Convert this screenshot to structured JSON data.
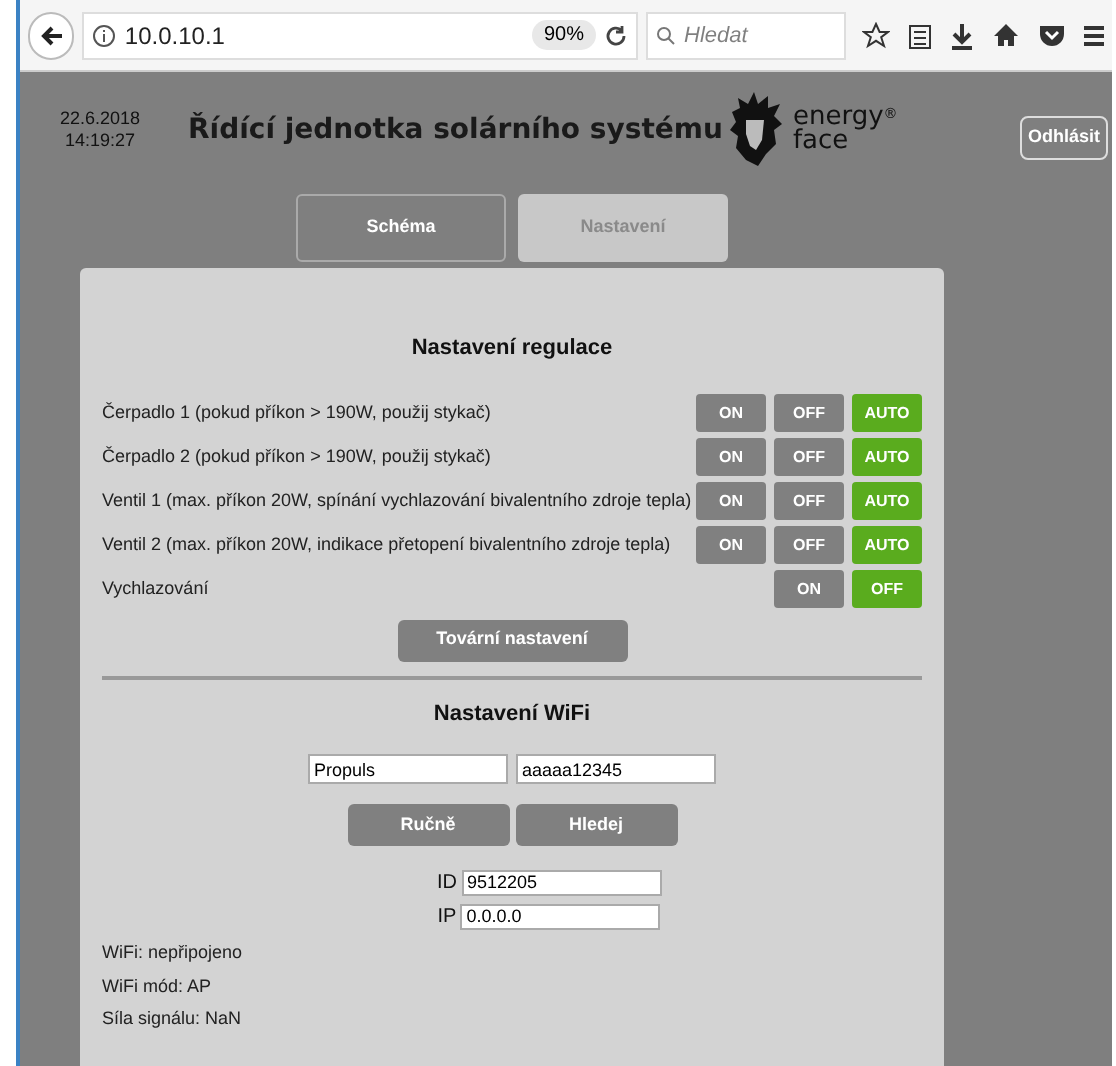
{
  "browser": {
    "url": "10.0.10.1",
    "zoom": "90%",
    "search": {
      "placeholder": "Hledat"
    }
  },
  "header": {
    "date": "22.6.2018",
    "time": "14:19:27",
    "title": "Řídící jednotka solárního systému",
    "logo": {
      "line_1": "energy",
      "line_2": "face",
      "mark": "®"
    },
    "logout": "Odhlásit"
  },
  "tabs": [
    {
      "label": "Schéma",
      "selected": false
    },
    {
      "label": "Nastavení",
      "selected": true
    }
  ],
  "regulation": {
    "heading": "Nastavení regulace",
    "rows": [
      {
        "label": "Čerpadlo 1 (pokud příkon > 190W, použij stykač)",
        "options": [
          {
            "label": "ON",
            "selected": false
          },
          {
            "label": "OFF",
            "selected": false
          },
          {
            "label": "AUTO",
            "selected": true
          }
        ]
      },
      {
        "label": "Čerpadlo 2 (pokud příkon > 190W, použij stykač)",
        "options": [
          {
            "label": "ON",
            "selected": false
          },
          {
            "label": "OFF",
            "selected": false
          },
          {
            "label": "AUTO",
            "selected": true
          }
        ]
      },
      {
        "label": "Ventil 1 (max. příkon 20W, spínání vychlazování bivalentního zdroje tepla)",
        "options": [
          {
            "label": "ON",
            "selected": false
          },
          {
            "label": "OFF",
            "selected": false
          },
          {
            "label": "AUTO",
            "selected": true
          }
        ]
      },
      {
        "label": "Ventil 2 (max. příkon 20W, indikace přetopení bivalentního zdroje tepla)",
        "options": [
          {
            "label": "ON",
            "selected": false
          },
          {
            "label": "OFF",
            "selected": false
          },
          {
            "label": "AUTO",
            "selected": true
          }
        ]
      },
      {
        "label": "Vychlazování",
        "options": [
          {
            "label": "ON",
            "selected": false
          },
          {
            "label": "OFF",
            "selected": true
          }
        ]
      }
    ],
    "factory_button": "Tovární nastavení"
  },
  "wifi": {
    "heading": "Nastavení WiFi",
    "ssid": "Propuls",
    "password": "aaaaa12345",
    "buttons": [
      "Ručně",
      "Hledej"
    ],
    "fields": [
      {
        "label": "ID",
        "value": "9512205"
      },
      {
        "label": "IP",
        "value": "0.0.0.0"
      }
    ],
    "status": [
      "WiFi: nepřipojeno",
      "WiFi mód: AP",
      "Síla signálu: NaN"
    ]
  }
}
